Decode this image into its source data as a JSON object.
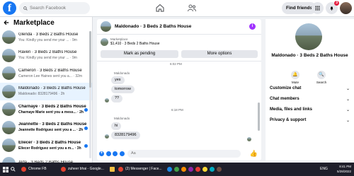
{
  "topbar": {
    "search_placeholder": "Search Facebook",
    "find_friends": "Find friends",
    "notification_count": "3"
  },
  "sidebar": {
    "title": "Marketplace",
    "conversations": [
      {
        "name": "Glenda · 3 Beds 2 Baths House",
        "snippet": "You: Kindly you send me your ... · 9m",
        "active": false,
        "unread": false
      },
      {
        "name": "Raven · 3 Beds 2 Baths House",
        "snippet": "You: Kindly you send me your ... · 9m",
        "active": false,
        "unread": false
      },
      {
        "name": "Cameron · 3 Beds 2 Baths House",
        "snippet": "Cameron Lee Haines sent you a... · 32m",
        "active": false,
        "unread": false
      },
      {
        "name": "Maldonado · 3 Beds 2 Baths House",
        "snippet": "Maldonado: 8328179496 · 2h",
        "active": true,
        "unread": false
      },
      {
        "name": "Charnaye · 3 Beds 2 Baths House",
        "snippet": "Charnaye Marie sent you a mess... · 2h",
        "active": false,
        "unread": true
      },
      {
        "name": "Jeannette · 3 Beds 2 Baths House",
        "snippet": "Jeannette Rodriguez sent you a ... · 2h",
        "active": false,
        "unread": true
      },
      {
        "name": "Eliecer · 3 Beds 2 Baths House",
        "snippet": "Eliecer Rodriguez sent you a m... · 3h",
        "active": false,
        "unread": true
      },
      {
        "name": "Alda · 3 Beds 2 Baths House",
        "snippet": "",
        "active": false,
        "unread": false
      }
    ]
  },
  "chat": {
    "title": "Maldonado · 3 Beds 2 Baths House",
    "market_label": "Marketplace",
    "market_price": "$1,410 · 3 Beds 2 Baths House",
    "mark_pending": "Mark as pending",
    "more_options": "More options",
    "time1": "6:02 PM",
    "sender1": "Maldonado",
    "msg1": "yes",
    "msg2": "tomorrow",
    "msg3": "??",
    "time2": "6:18 PM",
    "sender2": "Maldonado",
    "msg4": "hi",
    "msg5": "8328179496",
    "composer_placeholder": "Aa"
  },
  "rpanel": {
    "title": "Maldonado · 3 Beds 2 Baths House",
    "mute": "Mute",
    "search": "Search",
    "items": [
      "Customize chat",
      "Chat members",
      "Media, files and links",
      "Privacy & support"
    ]
  },
  "taskbar": {
    "chrome": "Chrome FB",
    "zuheer": "zuheer bhai - Google...",
    "messenger": "(2) Messenger | Face...",
    "lang": "ENG",
    "time": "8:41 PM",
    "date": "5/28/2022"
  },
  "colors": {
    "accent": "#1877f2",
    "unread_badge": "#e41e3f",
    "info": "#a033ff"
  }
}
